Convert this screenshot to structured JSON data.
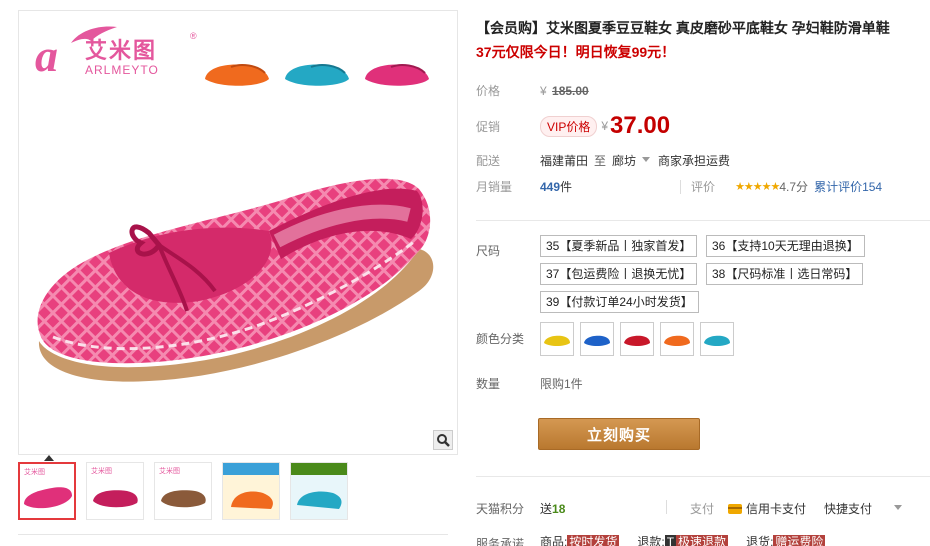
{
  "brand": {
    "logo_letter": "a",
    "name_cn": "艾米图",
    "name_en": "ARLMEYTO",
    "reg_mark": "®"
  },
  "product": {
    "title": "【会员购】艾米图夏季豆豆鞋女 真皮磨砂平底鞋女 孕妇鞋防滑单鞋",
    "promo": "37元仅限今日！明日恢复99元！"
  },
  "price": {
    "label": "价格",
    "currency": "¥",
    "original": "185.00",
    "promo_label": "促销",
    "vip_badge": "VIP价格",
    "current": "37.00"
  },
  "shipping": {
    "label": "配送",
    "from": "福建莆田",
    "to_word": "至",
    "to": "廊坊",
    "fee": "商家承担运费"
  },
  "sales": {
    "label": "月销量",
    "count": "449",
    "unit": "件",
    "review_label": "评价",
    "stars": "★★★★★",
    "score": "4.7分",
    "total_reviews": "累计评价154"
  },
  "sizes": {
    "label": "尺码",
    "options": [
      "35【夏季新品丨独家首发】",
      "36【支持10天无理由退换】",
      "37【包运费险丨退换无忧】",
      "38【尺码标准丨选日常码】",
      "39【付款订单24小时发货】"
    ]
  },
  "colors": {
    "label": "颜色分类",
    "swatches": [
      {
        "name": "yellow-shoe",
        "hex": "#e8c414"
      },
      {
        "name": "blue-shoe",
        "hex": "#1e62c8"
      },
      {
        "name": "red-shoe",
        "hex": "#c8182a"
      },
      {
        "name": "orange-shoe",
        "hex": "#f06a1e"
      },
      {
        "name": "teal-shoe",
        "hex": "#24a8c4"
      }
    ]
  },
  "quantity": {
    "label": "数量",
    "value": "限购1件"
  },
  "buy_button": "立刻购买",
  "points": {
    "label": "天猫积分",
    "prefix": "送",
    "value": "18"
  },
  "payment": {
    "label": "支付",
    "credit": "信用卡支付",
    "quick": "快捷支付"
  },
  "service": {
    "label": "服务承诺",
    "items": [
      {
        "text": "商品:",
        "tag": "按时发货"
      },
      {
        "text": "退款:",
        "tag": "极速退款",
        "tag_prefix": "T"
      },
      {
        "text": "退货:",
        "tag": "赠运费险"
      }
    ]
  },
  "colors_theme": {
    "accent": "#c40000",
    "brand_pink": "#e4579d",
    "shoe_pink": "#e0307a",
    "buy_button": "#c8893c"
  }
}
